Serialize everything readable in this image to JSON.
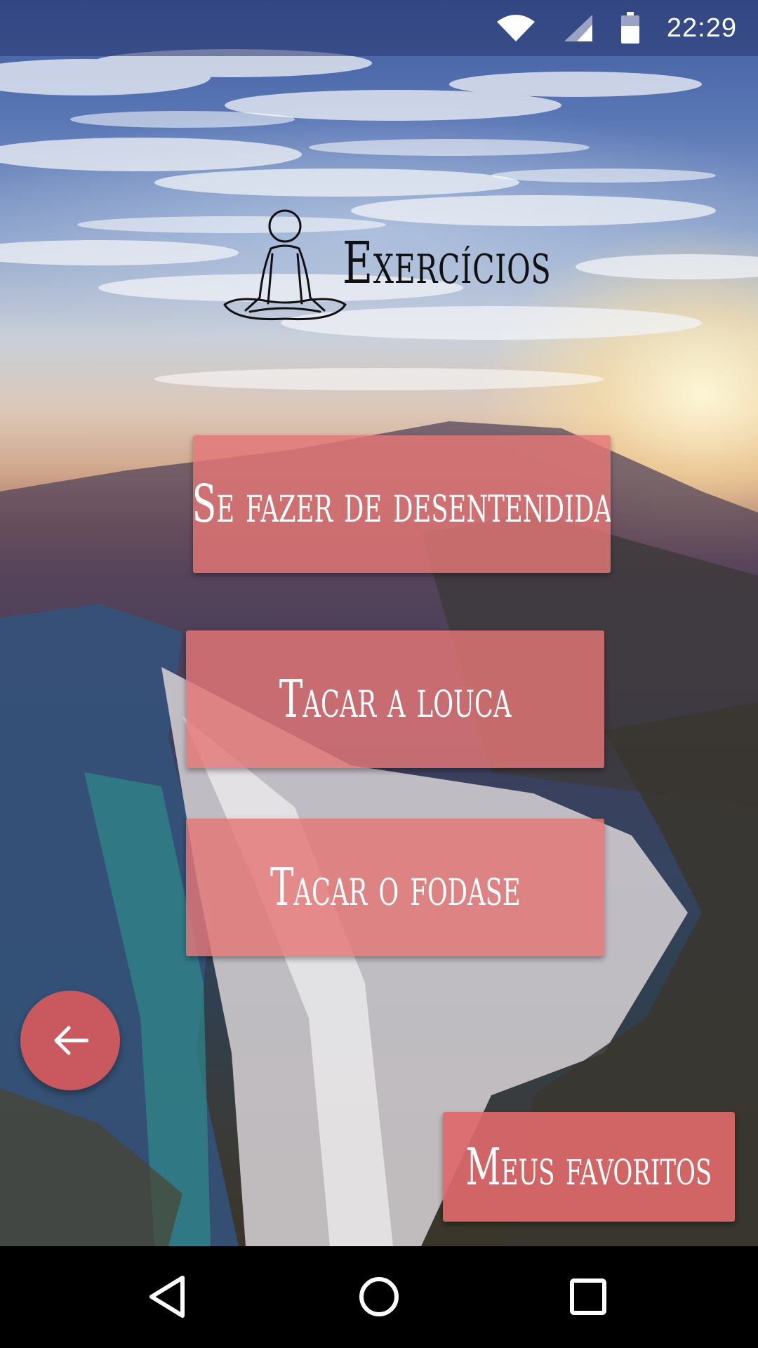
{
  "status_bar": {
    "time": "22:29",
    "icons": [
      "wifi-icon",
      "signal-icon",
      "battery-icon"
    ]
  },
  "header": {
    "title": "Exercícios",
    "icon": "meditation-icon"
  },
  "exercises": [
    {
      "label": "Se fazer de desentendida"
    },
    {
      "label": "Tacar a louca"
    },
    {
      "label": "Tacar o fodase"
    }
  ],
  "back_button": {
    "icon": "arrow-left-icon"
  },
  "favorites_button": {
    "label": "Meus favoritos"
  },
  "nav_bar": {
    "icons": [
      "nav-back-icon",
      "nav-home-icon",
      "nav-recents-icon"
    ]
  },
  "colors": {
    "button": "#e47676",
    "fab": "#c9595e",
    "title": "#111111",
    "button_text": "#ffffff"
  }
}
